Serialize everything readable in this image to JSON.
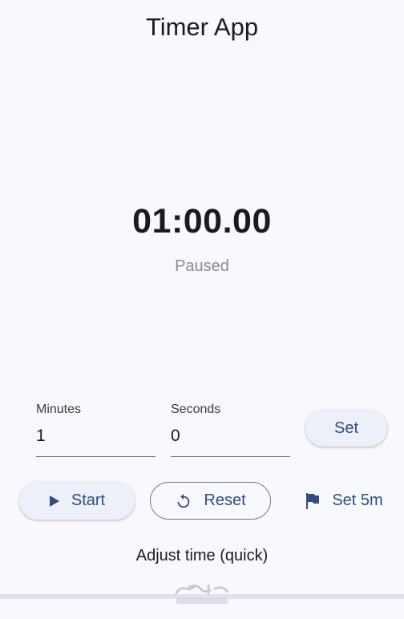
{
  "app": {
    "title": "Timer App"
  },
  "timer": {
    "display": "01:00.00",
    "status": "Paused"
  },
  "inputs": {
    "minutes": {
      "label": "Minutes",
      "value": "1"
    },
    "seconds": {
      "label": "Seconds",
      "value": "0"
    }
  },
  "buttons": {
    "set": "Set",
    "start": "Start",
    "reset": "Reset",
    "set5m": "Set 5m"
  },
  "icons": {
    "start": "play-icon",
    "reset": "restart-icon",
    "set5m": "flag-icon"
  },
  "adjust": {
    "label": "Adjust time (quick)"
  },
  "colors": {
    "background": "#f8f9fe",
    "accent": "#2e4d82",
    "muted": "#8a8a90"
  }
}
